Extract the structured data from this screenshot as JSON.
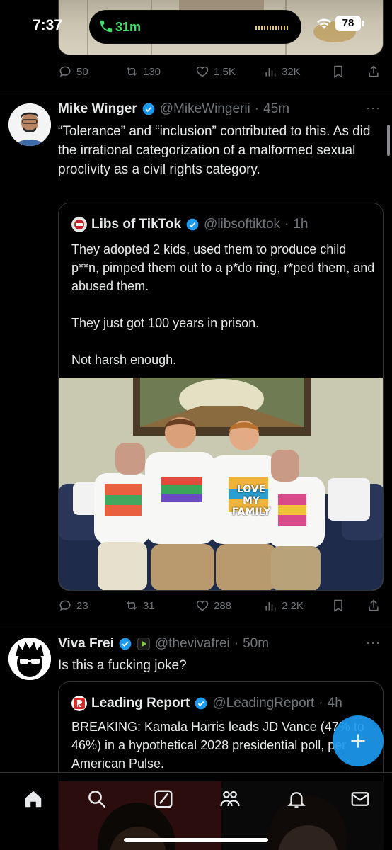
{
  "status_bar": {
    "time": "7:37",
    "call_duration": "31m",
    "battery": "78"
  },
  "top_tweet_actions": {
    "replies": "50",
    "reposts": "130",
    "likes": "1.5K",
    "views": "32K"
  },
  "tweets": [
    {
      "name": "Mike Winger",
      "handle": "@MikeWingerii",
      "time": "45m",
      "text": "“Tolerance” and “inclusion” contributed to this. As did the irrational categorization of a malformed sexual proclivity as a civil rights category.",
      "quote": {
        "name": "Libs of TikTok",
        "handle": "@libsoftiktok",
        "time": "1h",
        "text": "They adopted 2 kids, used them to produce child p**n, pimped them out to a p*do ring, r*ped them, and abused them.\n\nThey just got 100 years in prison.\n\nNot harsh enough.",
        "shirt_text": "LOVE MY FAMILY"
      },
      "actions": {
        "replies": "23",
        "reposts": "31",
        "likes": "288",
        "views": "2.2K"
      }
    },
    {
      "name": "Viva Frei",
      "handle": "@thevivafrei",
      "time": "50m",
      "text": "Is this a fucking joke?",
      "quote": {
        "name": "Leading Report",
        "handle": "@LeadingReport",
        "time": "4h",
        "text": "BREAKING: Kamala Harris leads JD Vance (47% to 46%) in a hypothetical 2028 presidential poll, per American Pulse."
      }
    }
  ],
  "separator": "·",
  "more_label": "···",
  "colors": {
    "accent": "#1d9bf0",
    "call_green": "#3ee06a",
    "muted": "#71767b",
    "divider": "#2f3336"
  },
  "icons": [
    "home-icon",
    "search-icon",
    "grok-icon",
    "communities-icon",
    "notifications-icon",
    "messages-icon",
    "compose-icon"
  ]
}
